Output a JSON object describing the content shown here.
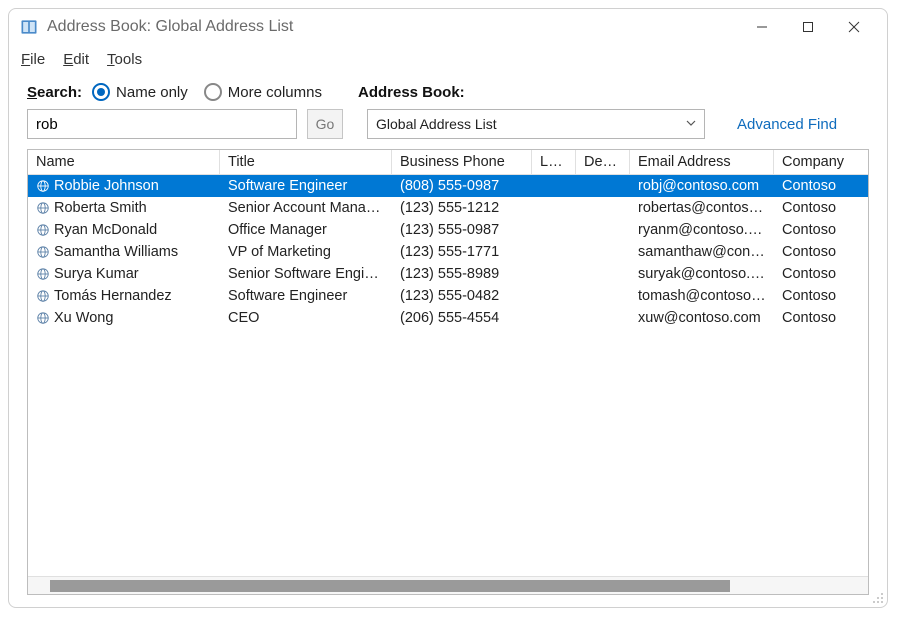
{
  "window": {
    "title": "Address Book: Global Address List"
  },
  "menu": {
    "file": "File",
    "edit": "Edit",
    "tools": "Tools"
  },
  "search": {
    "label": "Search:",
    "name_only": "Name only",
    "more_cols": "More columns",
    "value": "rob",
    "go": "Go"
  },
  "combo": {
    "label": "Address Book:",
    "value": "Global Address List"
  },
  "advanced": "Advanced Find",
  "columns": {
    "name": "Name",
    "title": "Title",
    "phone": "Business Phone",
    "loc": "Loc…",
    "dep": "Depa…",
    "email": "Email Address",
    "comp": "Company"
  },
  "rows": [
    {
      "name": "Robbie Johnson",
      "title": "Software Engineer",
      "phone": "(808) 555-0987",
      "loc": "",
      "dep": "",
      "email": "robj@contoso.com",
      "comp": "Contoso",
      "selected": true
    },
    {
      "name": "Roberta Smith",
      "title": "Senior Account Manager",
      "phone": "(123) 555-1212",
      "loc": "",
      "dep": "",
      "email": "robertas@contoso…",
      "comp": "Contoso",
      "selected": false
    },
    {
      "name": "Ryan McDonald",
      "title": "Office Manager",
      "phone": "(123) 555-0987",
      "loc": "",
      "dep": "",
      "email": "ryanm@contoso.c…",
      "comp": "Contoso",
      "selected": false
    },
    {
      "name": "Samantha Williams",
      "title": "VP of Marketing",
      "phone": "(123) 555-1771",
      "loc": "",
      "dep": "",
      "email": "samanthaw@cont…",
      "comp": "Contoso",
      "selected": false
    },
    {
      "name": "Surya Kumar",
      "title": "Senior Software Engineer",
      "phone": "(123) 555-8989",
      "loc": "",
      "dep": "",
      "email": "suryak@contoso.c…",
      "comp": "Contoso",
      "selected": false
    },
    {
      "name": "Tomás Hernandez",
      "title": "Software Engineer",
      "phone": "(123) 555-0482",
      "loc": "",
      "dep": "",
      "email": "tomash@contoso.…",
      "comp": "Contoso",
      "selected": false
    },
    {
      "name": "Xu Wong",
      "title": "CEO",
      "phone": "(206) 555-4554",
      "loc": "",
      "dep": "",
      "email": "xuw@contoso.com",
      "comp": "Contoso",
      "selected": false
    }
  ]
}
